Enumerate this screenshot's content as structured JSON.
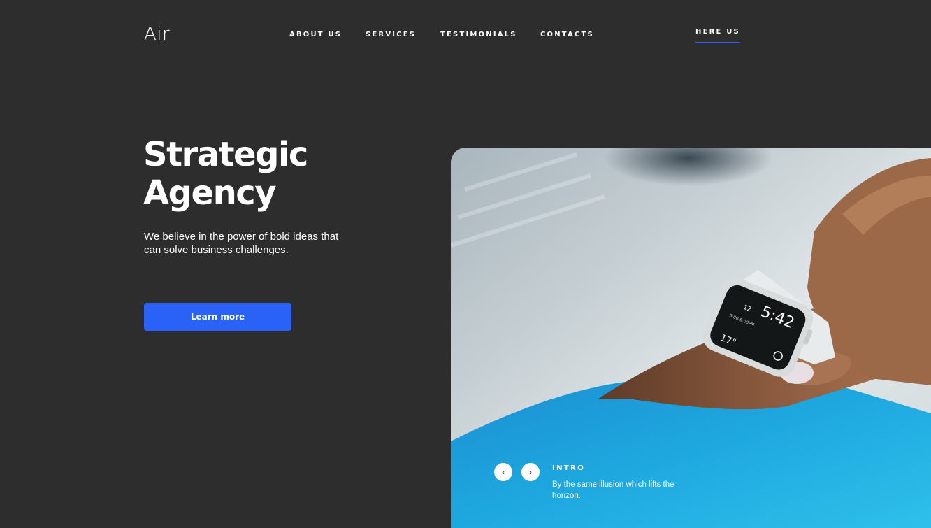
{
  "header": {
    "logo": "Air",
    "nav": [
      {
        "label": "ABOUT US"
      },
      {
        "label": "SERVICES"
      },
      {
        "label": "TESTIMONIALS"
      },
      {
        "label": "CONTACTS"
      }
    ],
    "cta_link": "HERE US"
  },
  "hero": {
    "title_line1": "Strategic",
    "title_line2": "Agency",
    "description": "We believe in the power of bold ideas that can solve business challenges.",
    "button_label": "Learn more"
  },
  "slider": {
    "prev_icon": "chevron-left-icon",
    "next_icon": "chevron-right-icon",
    "prev_glyph": "‹",
    "next_glyph": "›",
    "label": "INTRO",
    "text": "By the same illusion which lifts the horizon.",
    "watch": {
      "time": "5:42",
      "hour_small": "12",
      "line1": "5:00-6:00PM",
      "temperature": "17°"
    }
  },
  "colors": {
    "background": "#2d2d2d",
    "accent": "#2a61f6",
    "sleeve": "#1ea8e0"
  }
}
